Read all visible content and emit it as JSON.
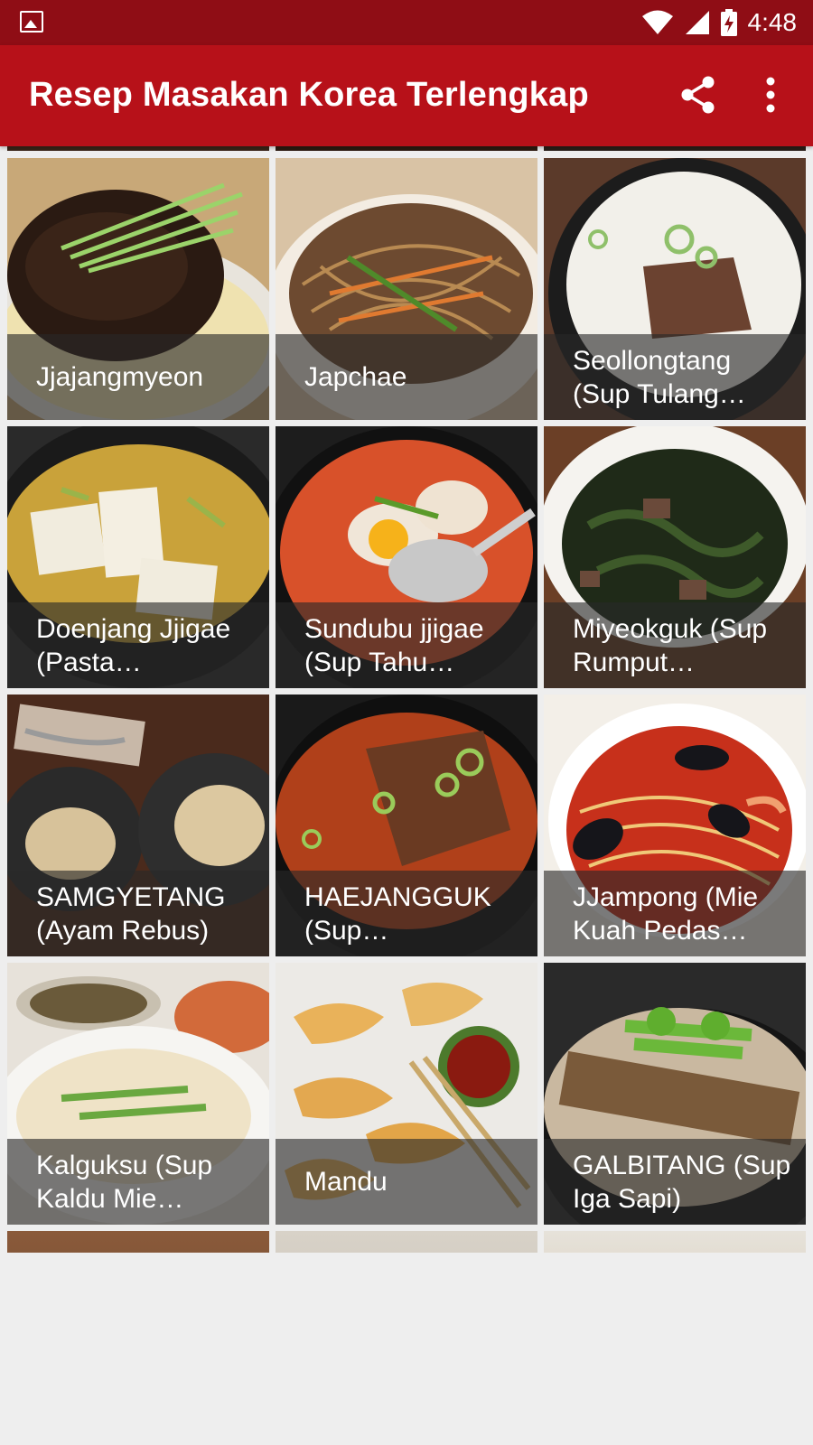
{
  "status_bar": {
    "time": "4:48",
    "icons": [
      "gallery-icon",
      "wifi-icon",
      "signal-icon",
      "battery-charging-icon"
    ]
  },
  "app_bar": {
    "title": "Resep Masakan Korea Terlengkap",
    "actions": [
      "share-icon",
      "more-vert-icon"
    ]
  },
  "colors": {
    "status_bar": "#8f0d15",
    "app_bar": "#b71119",
    "background": "#eeeeee",
    "caption_overlay": "rgba(40,40,40,0.62)"
  },
  "recipes": [
    {
      "name": "Jjajangmyeon",
      "caption": "Jjajangmyeon"
    },
    {
      "name": "Japchae",
      "caption": "Japchae"
    },
    {
      "name": "Seollongtang",
      "caption": "Seollongtang (Sup Tulang…"
    },
    {
      "name": "Doenjang Jjigae",
      "caption": "Doenjang Jjigae (Pasta…"
    },
    {
      "name": "Sundubu jjigae",
      "caption": "Sundubu jjigae (Sup Tahu…"
    },
    {
      "name": "Miyeokguk",
      "caption": "Miyeokguk (Sup Rumput…"
    },
    {
      "name": "SAMGYETANG",
      "caption": "SAMGYETANG (Ayam Rebus)"
    },
    {
      "name": "HAEJANGGUK",
      "caption": "HAEJANGGUK (Sup…"
    },
    {
      "name": "JJampong",
      "caption": "JJampong (Mie Kuah Pedas…"
    },
    {
      "name": "Kalguksu",
      "caption": "Kalguksu (Sup Kaldu Mie…"
    },
    {
      "name": "Mandu",
      "caption": "Mandu"
    },
    {
      "name": "GALBITANG",
      "caption": "GALBITANG (Sup Iga Sapi)"
    }
  ]
}
